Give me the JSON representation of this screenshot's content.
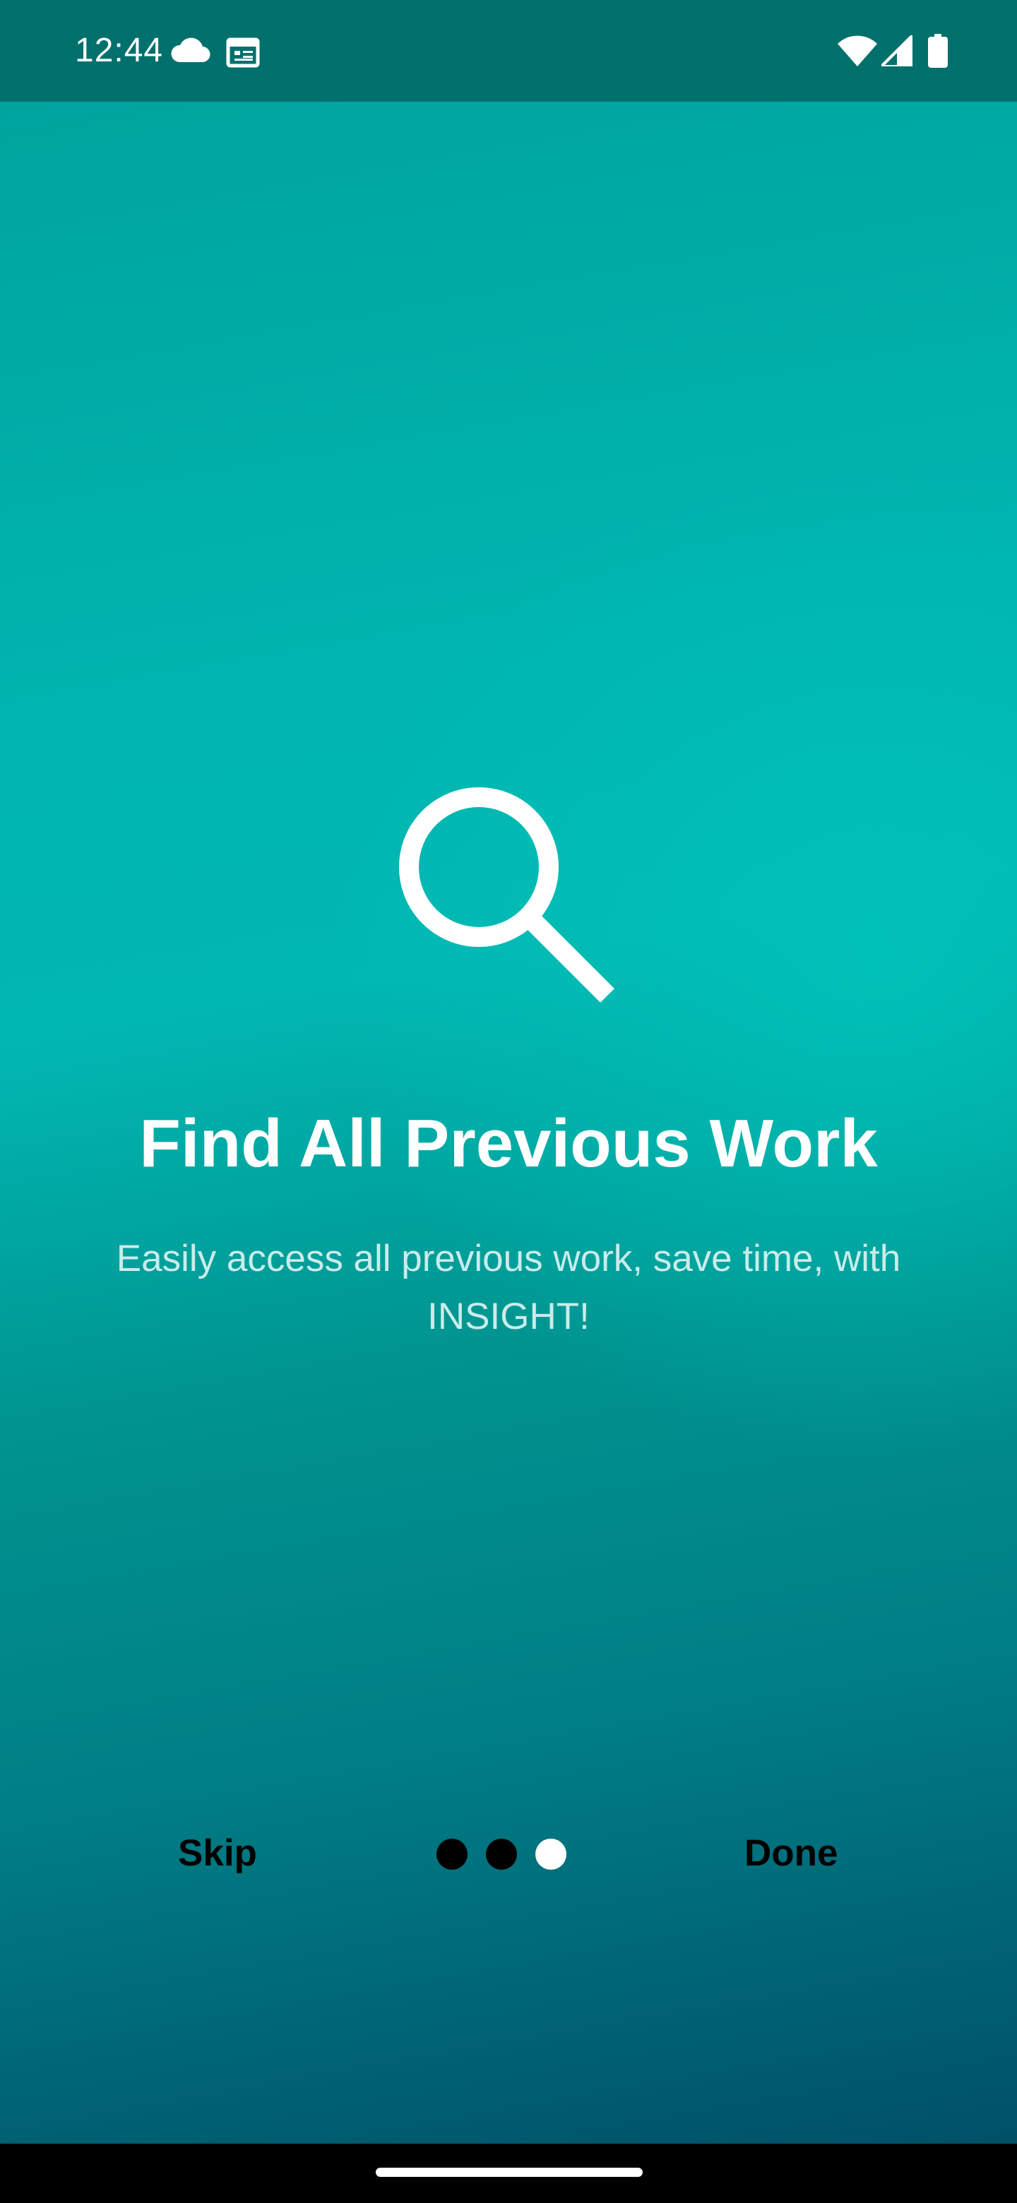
{
  "status_bar": {
    "time": "12:44",
    "left_icons": [
      "cloud-icon",
      "calendar-icon"
    ],
    "right_icons": [
      "wifi-icon",
      "signal-icon",
      "battery-icon"
    ]
  },
  "onboarding": {
    "icon": "search-icon",
    "title": "Find All Previous Work",
    "subtitle": "Easily access all previous work, save time, with INSIGHT!"
  },
  "footer": {
    "skip_label": "Skip",
    "done_label": "Done",
    "page_count": 3,
    "current_page": 3
  },
  "colors": {
    "status_bar": "#00706c",
    "gradient_top": "#00a19a",
    "gradient_mid": "#00b5b0",
    "gradient_bottom": "#005068",
    "dot_inactive": "#000000",
    "dot_active": "#ffffff",
    "title_text": "#ffffff",
    "subtitle_text": "#c9ecea"
  }
}
